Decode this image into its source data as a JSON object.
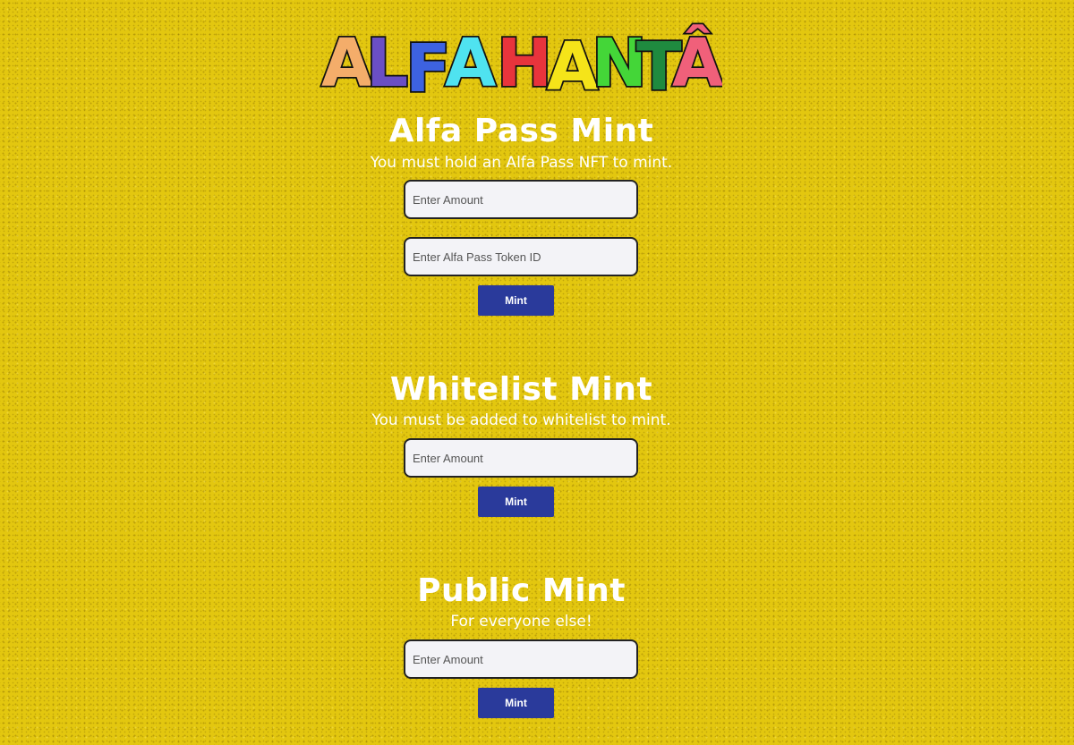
{
  "logo": {
    "letters": [
      "A",
      "L",
      "F",
      "A",
      "H",
      "A",
      "N",
      "T",
      "Â"
    ],
    "colors": [
      "#f4ad6a",
      "#6a4fc4",
      "#3d62e0",
      "#4fe3f0",
      "#e8343c",
      "#f5e419",
      "#44d638",
      "#1f8a3f",
      "#f0607a"
    ]
  },
  "alfa_pass": {
    "title": "Alfa Pass Mint",
    "subtitle": "You must hold an Alfa Pass NFT to mint.",
    "amount_placeholder": "Enter Amount",
    "token_placeholder": "Enter Alfa Pass Token ID",
    "button_label": "Mint"
  },
  "whitelist": {
    "title": "Whitelist Mint",
    "subtitle": "You must be added to whitelist to mint.",
    "amount_placeholder": "Enter Amount",
    "button_label": "Mint"
  },
  "public": {
    "title": "Public Mint",
    "subtitle": "For everyone else!",
    "amount_placeholder": "Enter Amount",
    "button_label": "Mint"
  },
  "colors": {
    "background": "#e3c70f",
    "button": "#2a3a9b",
    "field": "#f3f3f7"
  }
}
